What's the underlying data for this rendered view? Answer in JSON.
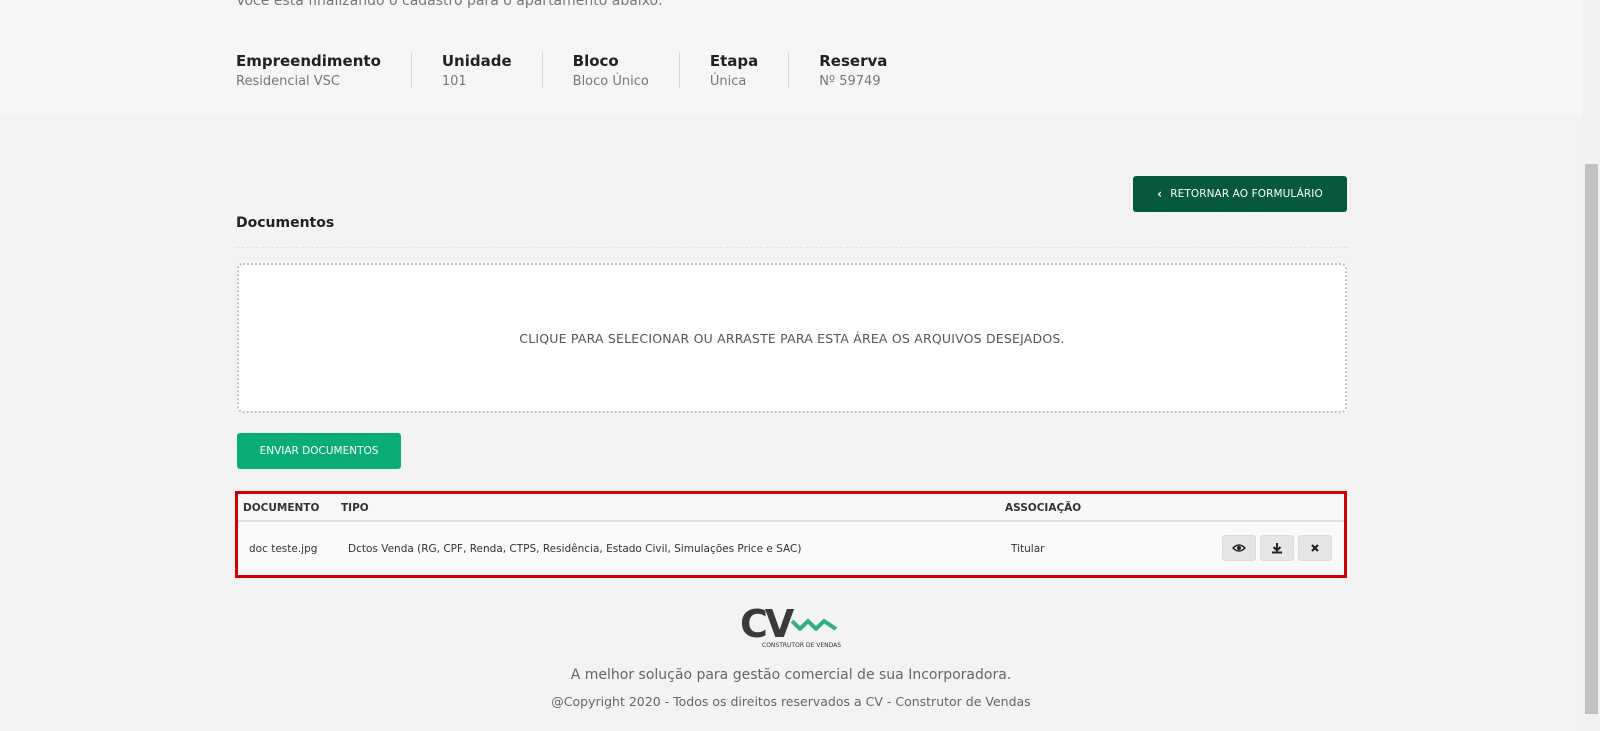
{
  "intro_text": "Você está finalizando o cadastro para o apartamento abaixo:",
  "info": [
    {
      "label": "Empreendimento",
      "value": "Residencial VSC"
    },
    {
      "label": "Unidade",
      "value": "101"
    },
    {
      "label": "Bloco",
      "value": "Bloco Único"
    },
    {
      "label": "Etapa",
      "value": "Única"
    },
    {
      "label": "Reserva",
      "value": "Nº 59749"
    }
  ],
  "return_button": {
    "icon": "chevron-left-icon",
    "label": "RETORNAR AO FORMULÁRIO"
  },
  "documents": {
    "title": "Documentos",
    "dropzone_text": "CLIQUE PARA SELECIONAR OU ARRASTE PARA ESTA ÁREA OS ARQUIVOS DESEJADOS.",
    "send_label": "ENVIAR DOCUMENTOS",
    "table": {
      "headers": {
        "document": "DOCUMENTO",
        "type": "TIPO",
        "association": "ASSOCIAÇÃO"
      },
      "rows": [
        {
          "document": "doc teste.jpg",
          "type": "Dctos Venda (RG, CPF, Renda, CTPS, Residência, Estado Civil, Simulações Price e SAC)",
          "association": "Titular",
          "actions": [
            "eye-icon",
            "download-icon",
            "close-icon"
          ]
        }
      ]
    }
  },
  "footer": {
    "logo_text": "CV",
    "logo_subtext": "CONSTRUTOR DE VENDAS",
    "tagline": "A melhor solução para gestão comercial de sua Incorporadora.",
    "copyright": "@Copyright 2020 - Todos os direitos reservados a CV - Construtor de Vendas"
  },
  "colors": {
    "brand_dark_green": "#06593f",
    "brand_green": "#0aae74",
    "highlight_red": "#d10000",
    "logo_teal": "#2fae8a"
  }
}
